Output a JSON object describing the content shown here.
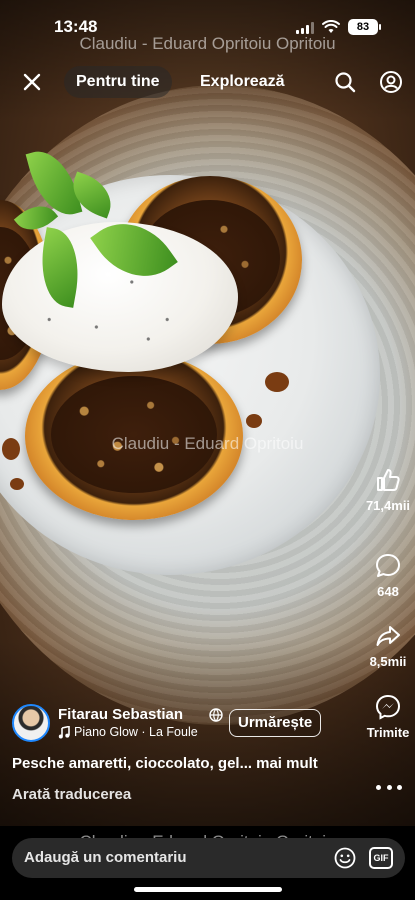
{
  "status_bar": {
    "time": "13:48",
    "battery": "83"
  },
  "watermark": {
    "text": "Claudiu - Eduard Opritoiu Opritoiu",
    "text_center": "Claudiu - Eduard Opritoiu"
  },
  "top_nav": {
    "close_icon": "close-icon",
    "tabs": [
      {
        "label": "Pentru tine",
        "active": true
      },
      {
        "label": "Explorează",
        "active": false
      }
    ],
    "search_icon": "search-icon",
    "profile_icon": "profile-icon"
  },
  "actions": {
    "like": {
      "icon": "thumbs-up-icon",
      "count": "71,4mii"
    },
    "comments": {
      "icon": "comment-icon",
      "count": "648"
    },
    "share": {
      "icon": "share-icon",
      "count": "8,5mii"
    },
    "send": {
      "icon": "messenger-icon",
      "label": "Trimite"
    },
    "more": {
      "icon": "more-dots-icon"
    }
  },
  "post": {
    "author": "Fitarau Sebastian",
    "privacy_icon": "globe-icon",
    "music_icon": "music-note-icon",
    "music": "Piano Glow · La Foule",
    "follow_label": "Urmărește",
    "caption": "Pesche amaretti, cioccolato, gel...",
    "more_link": "mai mult",
    "translate": "Arată traducerea"
  },
  "comment_bar": {
    "placeholder": "Adaugă un comentariu",
    "emoji_icon": "emoji-icon",
    "gif_label": "GIF"
  },
  "colors": {
    "accent_ring": "#1e88ff",
    "panel": "#000000",
    "comment_box": "#2a2a2a"
  }
}
